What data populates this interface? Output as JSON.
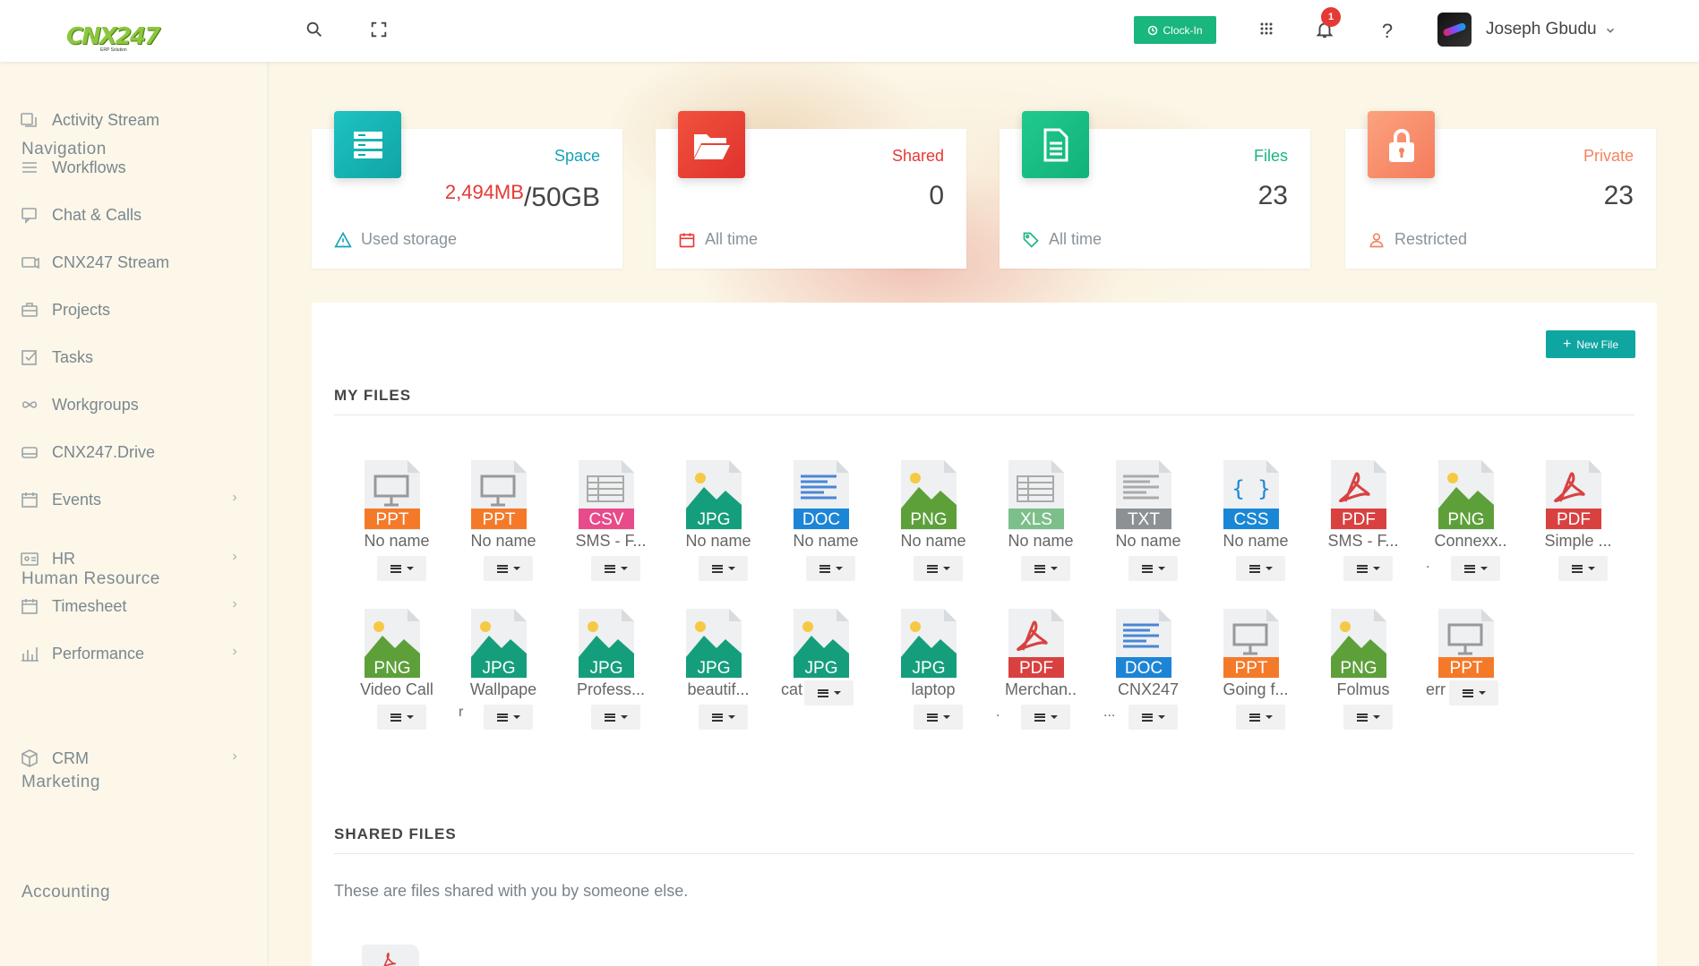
{
  "app": {
    "logo_text": "CNX247",
    "logo_sub": "ERP Solution"
  },
  "topbar": {
    "clock_in_label": "Clock-In",
    "notification_count": "1",
    "help_label": "?",
    "user_name": "Joseph Gbudu"
  },
  "sidebar": {
    "sections": [
      {
        "title": "Navigation",
        "items": [
          {
            "label": "Activity Stream",
            "icon": "activity-icon"
          },
          {
            "label": "Workflows",
            "icon": "menu-icon"
          },
          {
            "label": "Chat & Calls",
            "icon": "chat-icon"
          },
          {
            "label": "CNX247 Stream",
            "icon": "stream-icon"
          },
          {
            "label": "Projects",
            "icon": "briefcase-icon"
          },
          {
            "label": "Tasks",
            "icon": "checkbox-icon"
          },
          {
            "label": "Workgroups",
            "icon": "infinity-icon"
          },
          {
            "label": "CNX247.Drive",
            "icon": "drive-icon"
          },
          {
            "label": "Events",
            "icon": "calendar-icon"
          }
        ]
      },
      {
        "title": "Human Resource",
        "items": [
          {
            "label": "HR",
            "icon": "id-card-icon"
          },
          {
            "label": "Timesheet",
            "icon": "calendar-icon"
          },
          {
            "label": "Performance",
            "icon": "bar-chart-icon"
          }
        ]
      },
      {
        "title": "Marketing",
        "items": [
          {
            "label": "CRM",
            "icon": "cube-icon"
          }
        ]
      },
      {
        "title": "Accounting",
        "items": []
      }
    ]
  },
  "stats": {
    "space": {
      "label": "Space",
      "value_used": "2,494MB",
      "value_total": "/50GB",
      "footer": "Used storage",
      "color": "#17a2b8"
    },
    "shared": {
      "label": "Shared",
      "value": "0",
      "footer": "All time",
      "color": "#e53935"
    },
    "files": {
      "label": "Files",
      "value": "23",
      "footer": "All time",
      "color": "#19b67e"
    },
    "private": {
      "label": "Private",
      "value": "23",
      "footer": "Restricted",
      "color": "#f4845f"
    }
  },
  "main": {
    "new_file_label": "New File",
    "my_files_heading": "MY FILES",
    "shared_files_heading": "SHARED FILES",
    "shared_files_desc": "These are files shared with you by someone else.",
    "files": [
      {
        "type": "PPT",
        "name": "No name",
        "extra": ""
      },
      {
        "type": "PPT",
        "name": "No name",
        "extra": ""
      },
      {
        "type": "CSV",
        "name": "SMS - F...",
        "extra": ""
      },
      {
        "type": "JPG",
        "name": "No name",
        "extra": ""
      },
      {
        "type": "DOC",
        "name": "No name",
        "extra": ""
      },
      {
        "type": "PNG",
        "name": "No name",
        "extra": ""
      },
      {
        "type": "XLS",
        "name": "No name",
        "extra": ""
      },
      {
        "type": "TXT",
        "name": "No name",
        "extra": ""
      },
      {
        "type": "CSS",
        "name": "No name",
        "extra": ""
      },
      {
        "type": "PDF",
        "name": "SMS - F...",
        "extra": ""
      },
      {
        "type": "PNG",
        "name": "Connexx..",
        "extra": "."
      },
      {
        "type": "PDF",
        "name": "Simple ...",
        "extra": ""
      },
      {
        "type": "PNG",
        "name": "Video Call",
        "extra": ""
      },
      {
        "type": "JPG",
        "name": "Wallpape",
        "extra": "r"
      },
      {
        "type": "JPG",
        "name": "Profess...",
        "extra": ""
      },
      {
        "type": "JPG",
        "name": "beautif...",
        "extra": ""
      },
      {
        "type": "JPG",
        "name": "cat",
        "extra": ""
      },
      {
        "type": "JPG",
        "name": "laptop",
        "extra": ""
      },
      {
        "type": "PDF",
        "name": "Merchan..",
        "extra": "."
      },
      {
        "type": "DOC",
        "name": "CNX247",
        "extra": "..."
      },
      {
        "type": "PPT",
        "name": "Going f...",
        "extra": ""
      },
      {
        "type": "PNG",
        "name": "Folmus",
        "extra": ""
      },
      {
        "type": "PPT",
        "name": "err",
        "extra": ""
      }
    ]
  },
  "colors": {
    "PPT": "#f47a2a",
    "CSV": "#e84b8a",
    "JPG": "#159e7c",
    "DOC": "#1d85d6",
    "PNG": "#5da03a",
    "XLS": "#7cbf8a",
    "TXT": "#8c9196",
    "CSS": "#1a87d6",
    "PDF": "#d94141"
  }
}
